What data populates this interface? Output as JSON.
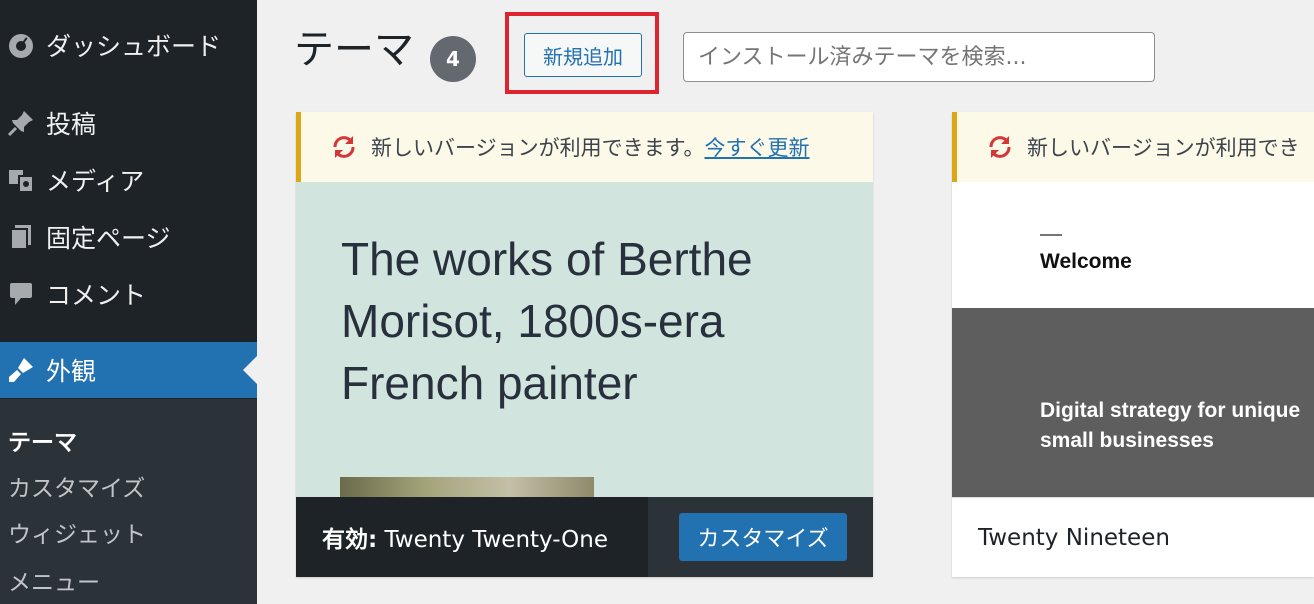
{
  "sidebar": {
    "items": [
      {
        "label": "ダッシュボード",
        "icon": "dashboard-icon"
      },
      {
        "label": "投稿",
        "icon": "pin-icon"
      },
      {
        "label": "メディア",
        "icon": "media-icon"
      },
      {
        "label": "固定ページ",
        "icon": "page-icon"
      },
      {
        "label": "コメント",
        "icon": "comment-icon"
      },
      {
        "label": "外観",
        "icon": "appearance-brush-icon",
        "active": true
      }
    ],
    "submenu": [
      "テーマ",
      "カスタマイズ",
      "ウィジェット",
      "メニュー"
    ]
  },
  "header": {
    "title": "テーマ",
    "count": "4",
    "add_new_label": "新規追加",
    "search_placeholder": "インストール済みテーマを検索..."
  },
  "themes": [
    {
      "notice_text": "新しいバージョンが利用できます。",
      "notice_link": "今すぐ更新",
      "screenshot_headline": "The works of Berthe Morisot, 1800s-era French painter",
      "active_prefix": "有効:",
      "name": "Twenty Twenty-One",
      "customize_label": "カスタマイズ"
    },
    {
      "notice_text": "新しいバージョンが利用でき",
      "screenshot_welcome": "Welcome",
      "screenshot_tagline": "Digital strategy for unique small businesses",
      "name": "Twenty Nineteen"
    }
  ],
  "colors": {
    "sidebar_bg": "#1d2327",
    "accent": "#2271b1",
    "highlight_outline": "#dc2530",
    "notice_border": "#dba617",
    "update_icon": "#d63638"
  }
}
